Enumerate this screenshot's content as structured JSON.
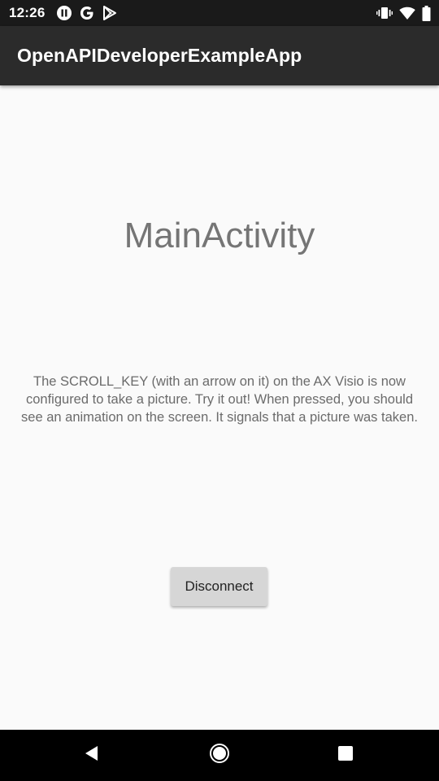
{
  "status_bar": {
    "time": "12:26",
    "left_icons": [
      "pause-circle-icon",
      "google-g-icon",
      "play-store-icon"
    ],
    "right_icons": [
      "vibrate-icon",
      "wifi-icon",
      "battery-icon"
    ]
  },
  "app_bar": {
    "title": "OpenAPIDeveloperExampleApp"
  },
  "main": {
    "heading": "MainActivity",
    "description": "The SCROLL_KEY (with an arrow on it) on the AX Visio is now configured to take a picture. Try it out! When pressed, you should see an animation on the screen. It signals that a picture was taken.",
    "disconnect_label": "Disconnect"
  },
  "nav_bar": {
    "buttons": [
      "back-icon",
      "home-icon",
      "recents-icon"
    ]
  },
  "colors": {
    "status_bar_bg": "#1a1a1a",
    "app_bar_bg": "#2b2b2b",
    "page_bg": "#fafafa",
    "button_bg": "#d6d6d6",
    "nav_bar_bg": "#000000"
  }
}
